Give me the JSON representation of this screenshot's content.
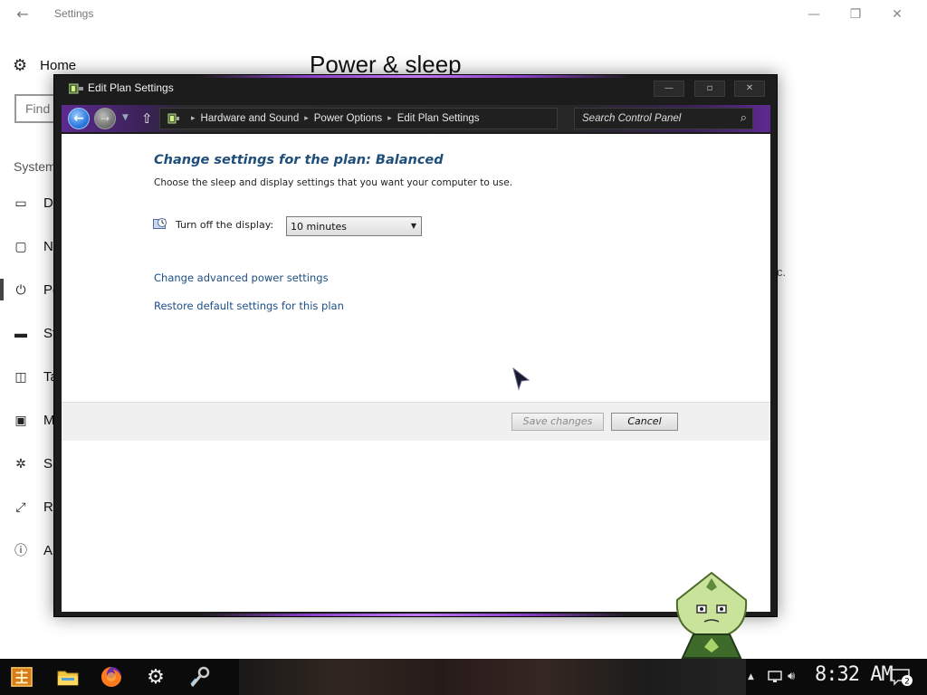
{
  "settings_app": {
    "window_title": "Settings",
    "home_label": "Home",
    "search_placeholder": "Find",
    "section_label": "System",
    "page_title": "Power & sleep",
    "nav_items": [
      {
        "label": "Di",
        "icon": "display-icon"
      },
      {
        "label": "N",
        "icon": "notifications-icon"
      },
      {
        "label": "Po",
        "icon": "power-icon"
      },
      {
        "label": "St",
        "icon": "storage-icon"
      },
      {
        "label": "Ta",
        "icon": "tablet-mode-icon"
      },
      {
        "label": "M",
        "icon": "multitasking-icon"
      },
      {
        "label": "Sh",
        "icon": "shared-experiences-icon"
      },
      {
        "label": "Re",
        "icon": "remote-desktop-icon"
      },
      {
        "label": "A",
        "icon": "about-icon"
      }
    ],
    "stray_text": "c."
  },
  "edit_plan_window": {
    "title": "Edit Plan Settings",
    "breadcrumbs": [
      "Hardware and Sound",
      "Power Options",
      "Edit Plan Settings"
    ],
    "search_placeholder": "Search Control Panel",
    "heading": "Change settings for the plan: Balanced",
    "subheading": "Choose the sleep and display settings that you want your computer to use.",
    "display_label": "Turn off the display:",
    "display_value": "10 minutes",
    "link_advanced": "Change advanced power settings",
    "link_restore": "Restore default settings for this plan",
    "save_label": "Save changes",
    "cancel_label": "Cancel"
  },
  "taskbar": {
    "clock": "8:32 AM",
    "notification_count": "2",
    "pinned": [
      "start-icon",
      "file-explorer-icon",
      "firefox-icon",
      "settings-gear-icon",
      "tools-icon"
    ],
    "tray": [
      "chevron-up-icon",
      "network-icon",
      "volume-icon"
    ]
  },
  "colors": {
    "heading": "#1e4e79",
    "link": "#1c4f86",
    "window_frame": "#1c1c1c",
    "accent_purple": "#8a3fc6"
  }
}
